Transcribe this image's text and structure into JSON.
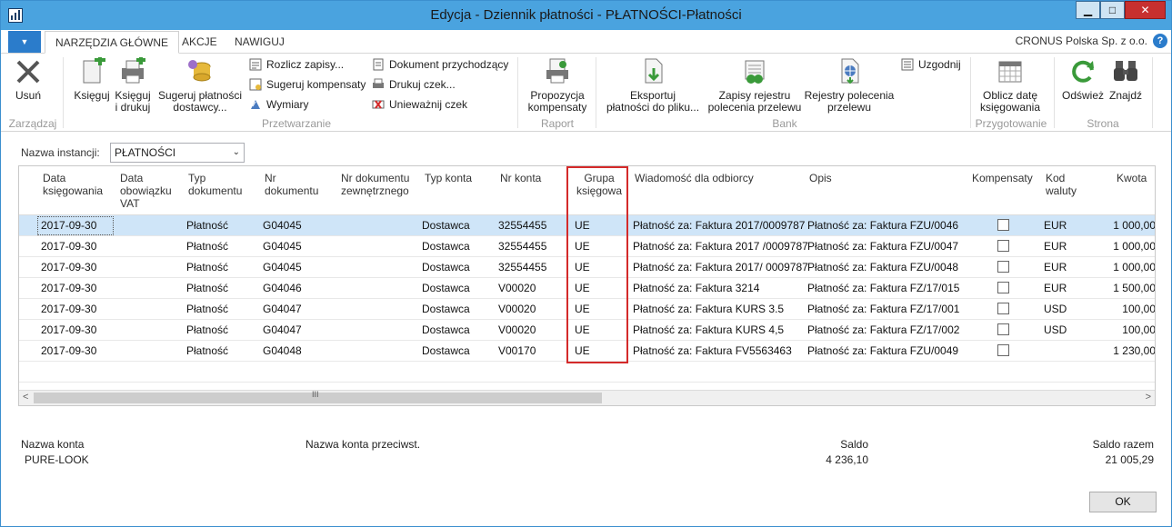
{
  "window": {
    "title": "Edycja - Dziennik płatności - PŁATNOŚCI-Płatności",
    "minimize": "▁",
    "maximize": "□",
    "close": "✕"
  },
  "tabs": [
    {
      "label": "NARZĘDZIA GŁÓWNE",
      "active": true
    },
    {
      "label": "AKCJE",
      "active": false
    },
    {
      "label": "NAWIGUJ",
      "active": false
    }
  ],
  "company": "CRONUS Polska Sp. z o.o.",
  "help": "?",
  "ribbon": {
    "zarzadzaj": {
      "label": "Zarządzaj",
      "usun": "Usuń"
    },
    "przetwarzanie": {
      "label": "Przetwarzanie",
      "ksieguj": "Księguj",
      "ksieguj_drukuj_1": "Księguj",
      "ksieguj_drukuj_2": "i drukuj",
      "sugeruj_1": "Sugeruj płatności",
      "sugeruj_2": "dostawcy...",
      "rozlicz": "Rozlicz zapisy...",
      "sugeruj_komp": "Sugeruj kompensaty",
      "wymiary": "Wymiary",
      "dokument": "Dokument przychodzący",
      "drukuj_czek": "Drukuj czek...",
      "uniewaznij": "Unieważnij czek"
    },
    "raport": {
      "label": "Raport",
      "propozycja_1": "Propozycja",
      "propozycja_2": "kompensaty"
    },
    "bank": {
      "label": "Bank",
      "eksportuj_1": "Eksportuj",
      "eksportuj_2": "płatności do pliku...",
      "zapisy_1": "Zapisy rejestru",
      "zapisy_2": "polecenia przelewu",
      "rejestry_1": "Rejestry polecenia",
      "rejestry_2": "przelewu",
      "uzgodnij": "Uzgodnij"
    },
    "przygotowanie": {
      "label": "Przygotowanie",
      "oblicz_1": "Oblicz datę",
      "oblicz_2": "księgowania"
    },
    "strona": {
      "label": "Strona",
      "odswiez": "Odśwież",
      "znajdz": "Znajdź"
    }
  },
  "instance": {
    "label": "Nazwa instancji:",
    "value": "PŁATNOŚCI"
  },
  "grid": {
    "headers": {
      "data_ks_1": "Data",
      "data_ks_2": "księgowania",
      "data_vat_1": "Data",
      "data_vat_2": "obowiązku",
      "data_vat_3": "VAT",
      "typ_dok_1": "Typ",
      "typ_dok_2": "dokumentu",
      "nr_dok_1": "Nr",
      "nr_dok_2": "dokumentu",
      "nr_zewn_1": "Nr dokumentu",
      "nr_zewn_2": "zewnętrznego",
      "typ_konta": "Typ konta",
      "nr_konta": "Nr konta",
      "grupa_1": "Grupa",
      "grupa_2": "księgowa",
      "wiadomosc": "Wiadomość dla odbiorcy",
      "opis": "Opis",
      "kompensata": "Kompensaty",
      "waluta_1": "Kod",
      "waluta_2": "waluty",
      "kwota": "Kwota"
    },
    "rows": [
      {
        "data": "2017-09-30",
        "typ": "Płatność",
        "nr": "G04045",
        "typ_konta": "Dostawca",
        "nr_konta": "32554455",
        "grupa": "UE",
        "wiad": "Płatność za: Faktura 2017/0009787",
        "opis": "Płatność za: Faktura FZU/0046",
        "waluta": "EUR",
        "kwota": "1 000,00"
      },
      {
        "data": "2017-09-30",
        "typ": "Płatność",
        "nr": "G04045",
        "typ_konta": "Dostawca",
        "nr_konta": "32554455",
        "grupa": "UE",
        "wiad": "Płatność za: Faktura 2017 /0009787",
        "opis": "Płatność za: Faktura FZU/0047",
        "waluta": "EUR",
        "kwota": "1 000,00"
      },
      {
        "data": "2017-09-30",
        "typ": "Płatność",
        "nr": "G04045",
        "typ_konta": "Dostawca",
        "nr_konta": "32554455",
        "grupa": "UE",
        "wiad": "Płatność za: Faktura 2017/ 0009787",
        "opis": "Płatność za: Faktura FZU/0048",
        "waluta": "EUR",
        "kwota": "1 000,00"
      },
      {
        "data": "2017-09-30",
        "typ": "Płatność",
        "nr": "G04046",
        "typ_konta": "Dostawca",
        "nr_konta": "V00020",
        "grupa": "UE",
        "wiad": "Płatność za: Faktura 3214",
        "opis": "Płatność za: Faktura FZ/17/015",
        "waluta": "EUR",
        "kwota": "1 500,00"
      },
      {
        "data": "2017-09-30",
        "typ": "Płatność",
        "nr": "G04047",
        "typ_konta": "Dostawca",
        "nr_konta": "V00020",
        "grupa": "UE",
        "wiad": "Płatność za: Faktura KURS 3.5",
        "opis": "Płatność za: Faktura FZ/17/001",
        "waluta": "USD",
        "kwota": "100,00"
      },
      {
        "data": "2017-09-30",
        "typ": "Płatność",
        "nr": "G04047",
        "typ_konta": "Dostawca",
        "nr_konta": "V00020",
        "grupa": "UE",
        "wiad": "Płatność za: Faktura KURS 4,5",
        "opis": "Płatność za: Faktura FZ/17/002",
        "waluta": "USD",
        "kwota": "100,00"
      },
      {
        "data": "2017-09-30",
        "typ": "Płatność",
        "nr": "G04048",
        "typ_konta": "Dostawca",
        "nr_konta": "V00170",
        "grupa": "UE",
        "wiad": "Płatność za: Faktura FV5563463",
        "opis": "Płatność za: Faktura FZU/0049",
        "waluta": "",
        "kwota": "1 230,00"
      }
    ],
    "scroll_left": "<",
    "scroll_right": ">",
    "scroll_grip": "III"
  },
  "footer": {
    "nazwa_konta_label": "Nazwa konta",
    "nazwa_konta_value": "PURE-LOOK",
    "przeciwst_label": "Nazwa konta przeciwst.",
    "saldo_label": "Saldo",
    "saldo_value": "4 236,10",
    "saldo_razem_label": "Saldo razem",
    "saldo_razem_value": "21 005,29",
    "ok": "OK"
  }
}
